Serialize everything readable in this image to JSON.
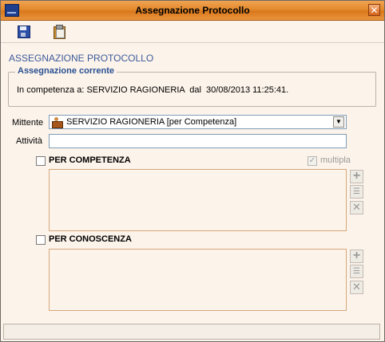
{
  "window": {
    "title": "Assegnazione Protocollo"
  },
  "heading": "ASSEGNAZIONE PROTOCOLLO",
  "current_assignment": {
    "legend": "Assegnazione corrente",
    "text": "In competenza a: SERVIZIO RAGIONERIA  dal  30/08/2013 11:25:41."
  },
  "form": {
    "mittente_label": "Mittente",
    "mittente_value": "SERVIZIO RAGIONERIA [per Competenza]",
    "attivita_label": "Attività",
    "attivita_value": ""
  },
  "competenza": {
    "label": "PER COMPETENZA",
    "checked": false
  },
  "multipla": {
    "label": "multipla",
    "checked": true,
    "enabled": false
  },
  "conoscenza": {
    "label": "PER CONOSCENZA",
    "checked": false
  },
  "icons": {
    "app": "app-icon",
    "save": "save-icon",
    "clipboard": "clipboard-icon",
    "add": "add-icon",
    "tree": "tree-list-icon",
    "delete": "delete-icon",
    "close": "close-icon"
  },
  "colors": {
    "titlebar": "#e48a2e",
    "background": "#fcf3ea",
    "heading": "#3b5a9c",
    "legend": "#284f92"
  }
}
